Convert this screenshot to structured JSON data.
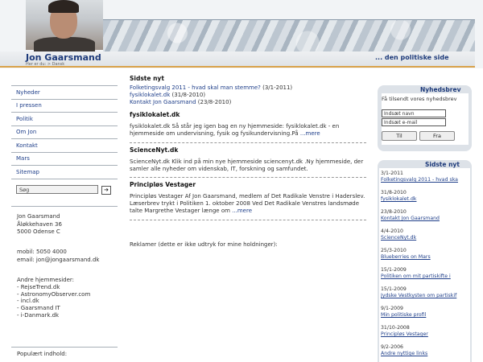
{
  "header": {
    "site_name": "Jon Gaarsmand",
    "breadcrumb": "Her er du:  > Dansk",
    "tagline": "... den politiske side"
  },
  "nav": {
    "items": [
      "Nyheder",
      "I pressen",
      "Politik",
      "Om Jon",
      "Kontakt",
      "Mars",
      "Sitemap"
    ]
  },
  "search": {
    "value": "Søg",
    "button_icon": "arrow-right-icon"
  },
  "address": {
    "lines": [
      "Jon Gaarsmand",
      "Åløkkehaven 36",
      "5000 Odense C"
    ]
  },
  "contact": {
    "lines": [
      "mobil: 5050 4000",
      "email: jon@jongaarsmand.dk"
    ]
  },
  "other_sites": {
    "heading": "Andre hjemmesider:",
    "items": [
      "- RejseTrend.dk",
      "- AstronomyObserver.com",
      "- incl.dk",
      "- Gaarsmand IT",
      "- i-Danmark.dk"
    ]
  },
  "popular": {
    "heading": "Populært indhold:"
  },
  "main": {
    "latest": {
      "heading": "Sidste nyt",
      "items": [
        {
          "link": "Folketingsvalg 2011 - hvad skal man stemme?",
          "date": " (3/1-2011)"
        },
        {
          "link": "fysiklokalet.dk",
          "date": " (31/8-2010)"
        },
        {
          "link": "Kontakt Jon Gaarsmand",
          "date": " (23/8-2010)"
        }
      ]
    },
    "articles": [
      {
        "heading": "fysiklokalet.dk",
        "text": "fysiklokalet.dk Så står jeg igen bag en ny hjemmeside: fysiklokalet.dk - en hjemmeside om undervisning, fysik og fysikundervisning.På ",
        "more": "...mere"
      },
      {
        "heading": "ScienceNyt.dk",
        "text": "ScienceNyt.dk Klik ind på min nye hjemmeside sciencenyt.dk .Ny hjemmeside, der samler alle nyheder om videnskab, IT, forskning og samfundet.",
        "more": ""
      },
      {
        "heading": "Principløs Vestager",
        "text": "Principløs Vestager Af Jon Gaarsmand, medlem af Det Radikale Venstre i Haderslev. Læserbrev trykt i Politiken 1. oktober 2008 Ved Det Radikale Venstres landsmøde talte Margrethe Vestager længe om ",
        "more": "...mere"
      }
    ],
    "ads_note": "Reklamer (dette er ikke udtryk for mine holdninger):"
  },
  "newsletter": {
    "title": "Nyhedsbrev",
    "description": "Få tilsendt vores nyhedsbrev",
    "name_placeholder": "Indsæt navn",
    "email_placeholder": "Indsæt e-mail",
    "subscribe_label": "Til",
    "unsubscribe_label": "Fra"
  },
  "news": {
    "title": "Sidste nyt",
    "entries": [
      {
        "date": "3/1-2011",
        "link": "Folketingsvalg 2011 - hvad ska"
      },
      {
        "date": "31/8-2010",
        "link": "fysiklokalet.dk"
      },
      {
        "date": "23/8-2010",
        "link": "Kontakt Jon Gaarsmand"
      },
      {
        "date": "4/4-2010",
        "link": "ScienceNyt.dk"
      },
      {
        "date": "25/3-2010",
        "link": "Blueberries on Mars"
      },
      {
        "date": "15/1-2009",
        "link": "Politiken om mit partiskifte i"
      },
      {
        "date": "15/1-2009",
        "link": "Jydske Vestkysten om partiskif"
      },
      {
        "date": "9/1-2009",
        "link": "Min politiske profil"
      },
      {
        "date": "31/10-2008",
        "link": "Principløs Vestager"
      },
      {
        "date": "9/2-2006",
        "link": "Andre nyttige links"
      }
    ]
  }
}
